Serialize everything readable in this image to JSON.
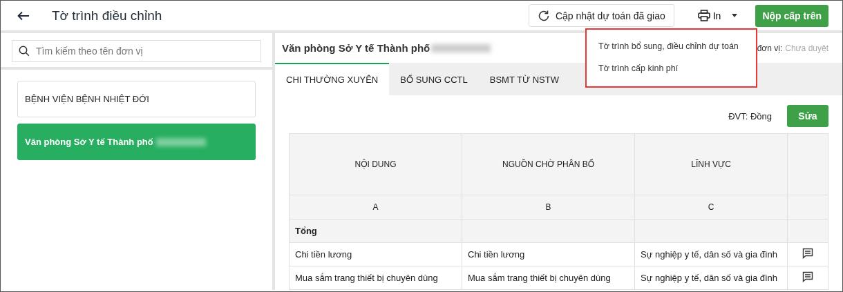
{
  "header": {
    "title": "Tờ trình điều chỉnh",
    "update_button": "Cập nhật dự toán đã giao",
    "print_button": "In",
    "submit_button": "Nộp cấp trên"
  },
  "print_menu": {
    "items": [
      "Tờ trình bổ sung, điều chỉnh dự toán",
      "Tờ trình cấp kinh phí"
    ]
  },
  "sidebar": {
    "search": {
      "placeholder": "Tìm kiếm theo tên đơn vị"
    },
    "items": [
      {
        "label": "BỆNH VIỆN BỆNH NHIỆT ĐỚI",
        "selected": false
      },
      {
        "label": "Văn phòng Sở Y tế Thành phố",
        "selected": true
      }
    ]
  },
  "detail": {
    "title": "Văn phòng Sở Y tế Thành phố",
    "status_label": "đơn vị:",
    "status_value": "Chưa duyệt",
    "tabs": [
      {
        "label": "CHI THƯỜNG XUYÊN",
        "selected": true
      },
      {
        "label": "BỔ SUNG CCTL",
        "selected": false
      },
      {
        "label": "BSMT TỪ NSTW",
        "selected": false
      }
    ],
    "unit": "ĐVT: Đồng",
    "edit_button": "Sửa",
    "table": {
      "columns": [
        "NỘI DUNG",
        "NGUỒN CHỜ PHÂN BỔ",
        "LĨNH VỰC"
      ],
      "column_codes": [
        "A",
        "B",
        "C"
      ],
      "rows": [
        {
          "kind": "total",
          "cells": [
            "Tổng",
            "",
            ""
          ]
        },
        {
          "kind": "item",
          "cells": [
            "Chi tiền lương",
            "Chi tiền lương",
            "Sự nghiệp y tế, dân số và gia đình"
          ]
        },
        {
          "kind": "item",
          "cells": [
            "Mua sắm trang thiết bị chuyên dùng",
            "Mua sắm trang thiết bị chuyên dùng",
            "Sự nghiệp y tế, dân số và gia đình"
          ]
        }
      ]
    }
  }
}
